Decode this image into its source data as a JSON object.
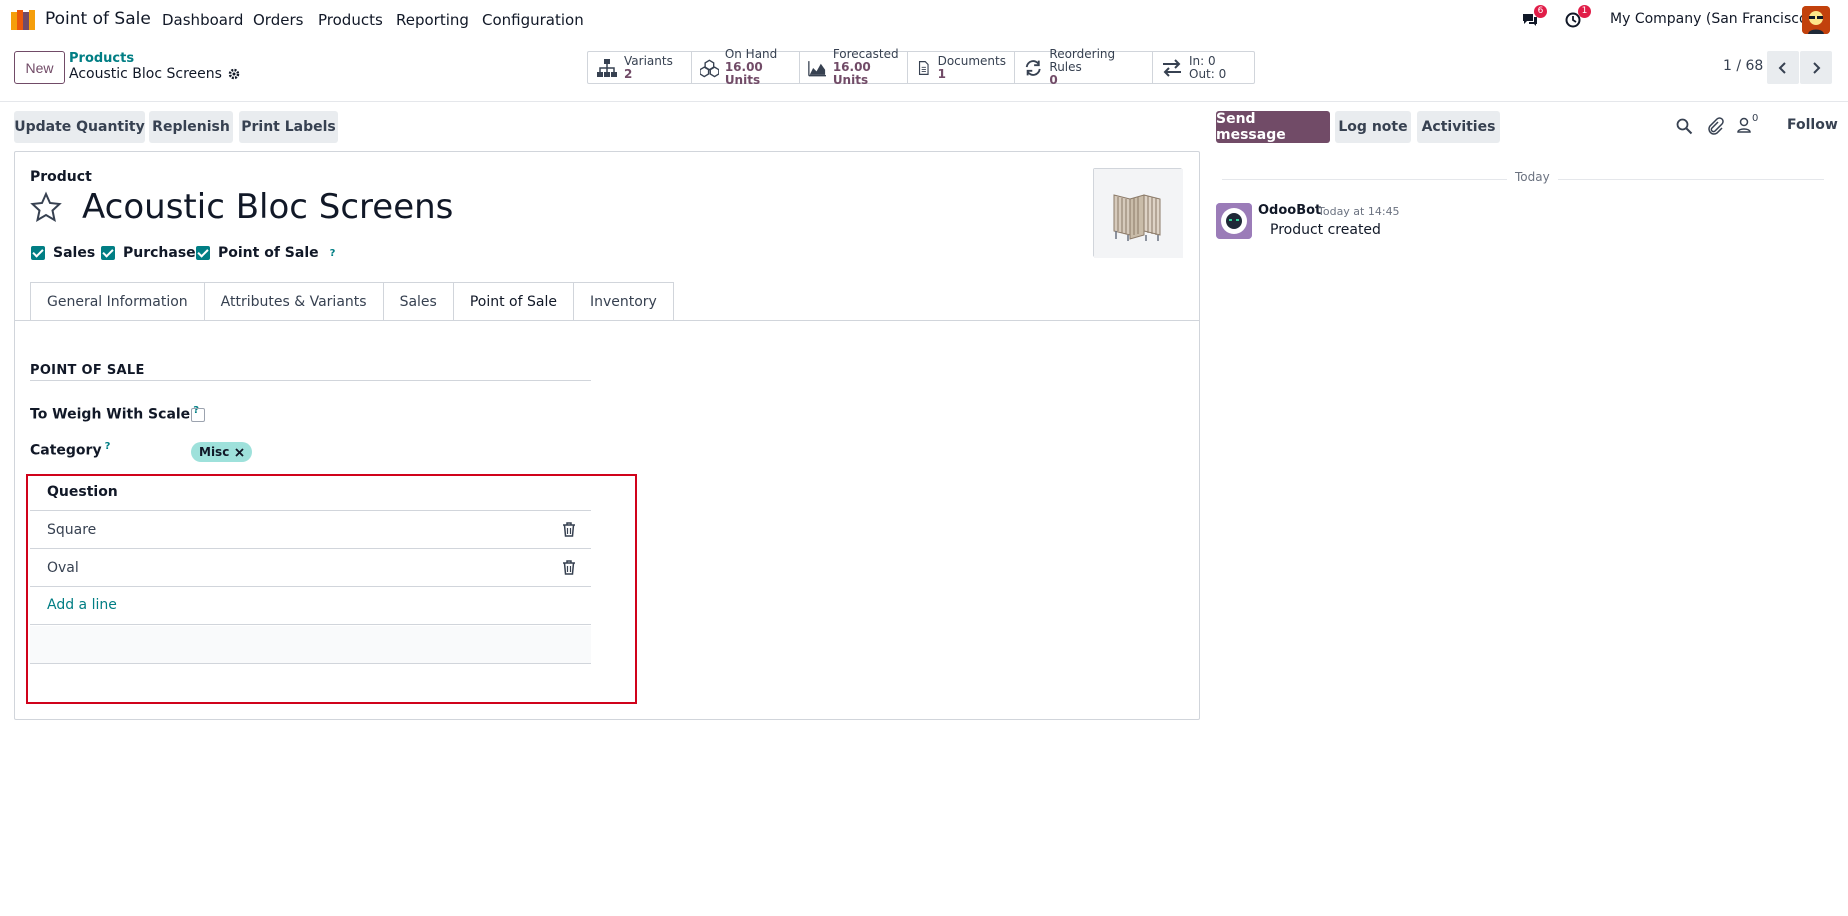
{
  "navbar": {
    "app_name": "Point of Sale",
    "menu": [
      "Dashboard",
      "Orders",
      "Products",
      "Reporting",
      "Configuration"
    ],
    "messages_badge": "6",
    "activities_badge": "1",
    "company": "My Company (San Francisco)"
  },
  "control_panel": {
    "new_label": "New",
    "breadcrumb_parent": "Products",
    "breadcrumb_current": "Acoustic Bloc Screens",
    "pager": "1 / 68"
  },
  "stats": [
    {
      "label": "Variants",
      "value": "2",
      "icon": "sitemap-icon"
    },
    {
      "label": "On Hand",
      "value": "16.00 Units",
      "icon": "cubes-icon"
    },
    {
      "label": "Forecasted",
      "value": "16.00 Units",
      "icon": "area-chart-icon"
    },
    {
      "label": "Documents",
      "value": "1",
      "icon": "document-icon"
    },
    {
      "label": "Reordering Rules",
      "value": "0",
      "icon": "refresh-icon"
    },
    {
      "label": "In: 0",
      "value": "Out: 0",
      "icon": "exchange-icon"
    }
  ],
  "actions": {
    "update_quantity": "Update Quantity",
    "replenish": "Replenish",
    "print_labels": "Print Labels"
  },
  "form": {
    "product_label": "Product",
    "title": "Acoustic Bloc Screens",
    "checkboxes": [
      "Sales",
      "Purchase",
      "Point of Sale"
    ],
    "help_mark": "?",
    "tabs": [
      "General Information",
      "Attributes & Variants",
      "Sales",
      "Point of Sale",
      "Inventory"
    ],
    "active_tab": "Point of Sale",
    "section_title": "POINT OF SALE",
    "to_weigh_label": "To Weigh With Scale",
    "category_label": "Category",
    "category_tag": "Misc",
    "table_header": "Question",
    "rows": [
      "Square",
      "Oval"
    ],
    "add_line": "Add a line"
  },
  "chatter": {
    "send_message": "Send message",
    "log_note": "Log note",
    "activities": "Activities",
    "followers_count": "0",
    "follow": "Follow",
    "today": "Today",
    "author": "OdooBot",
    "time": "Today at 14:45",
    "message": "Product created"
  },
  "colors": {
    "primary": "#714b67",
    "link": "#017e84",
    "tag": "#9ee1db",
    "highlight": "#d0021b"
  }
}
